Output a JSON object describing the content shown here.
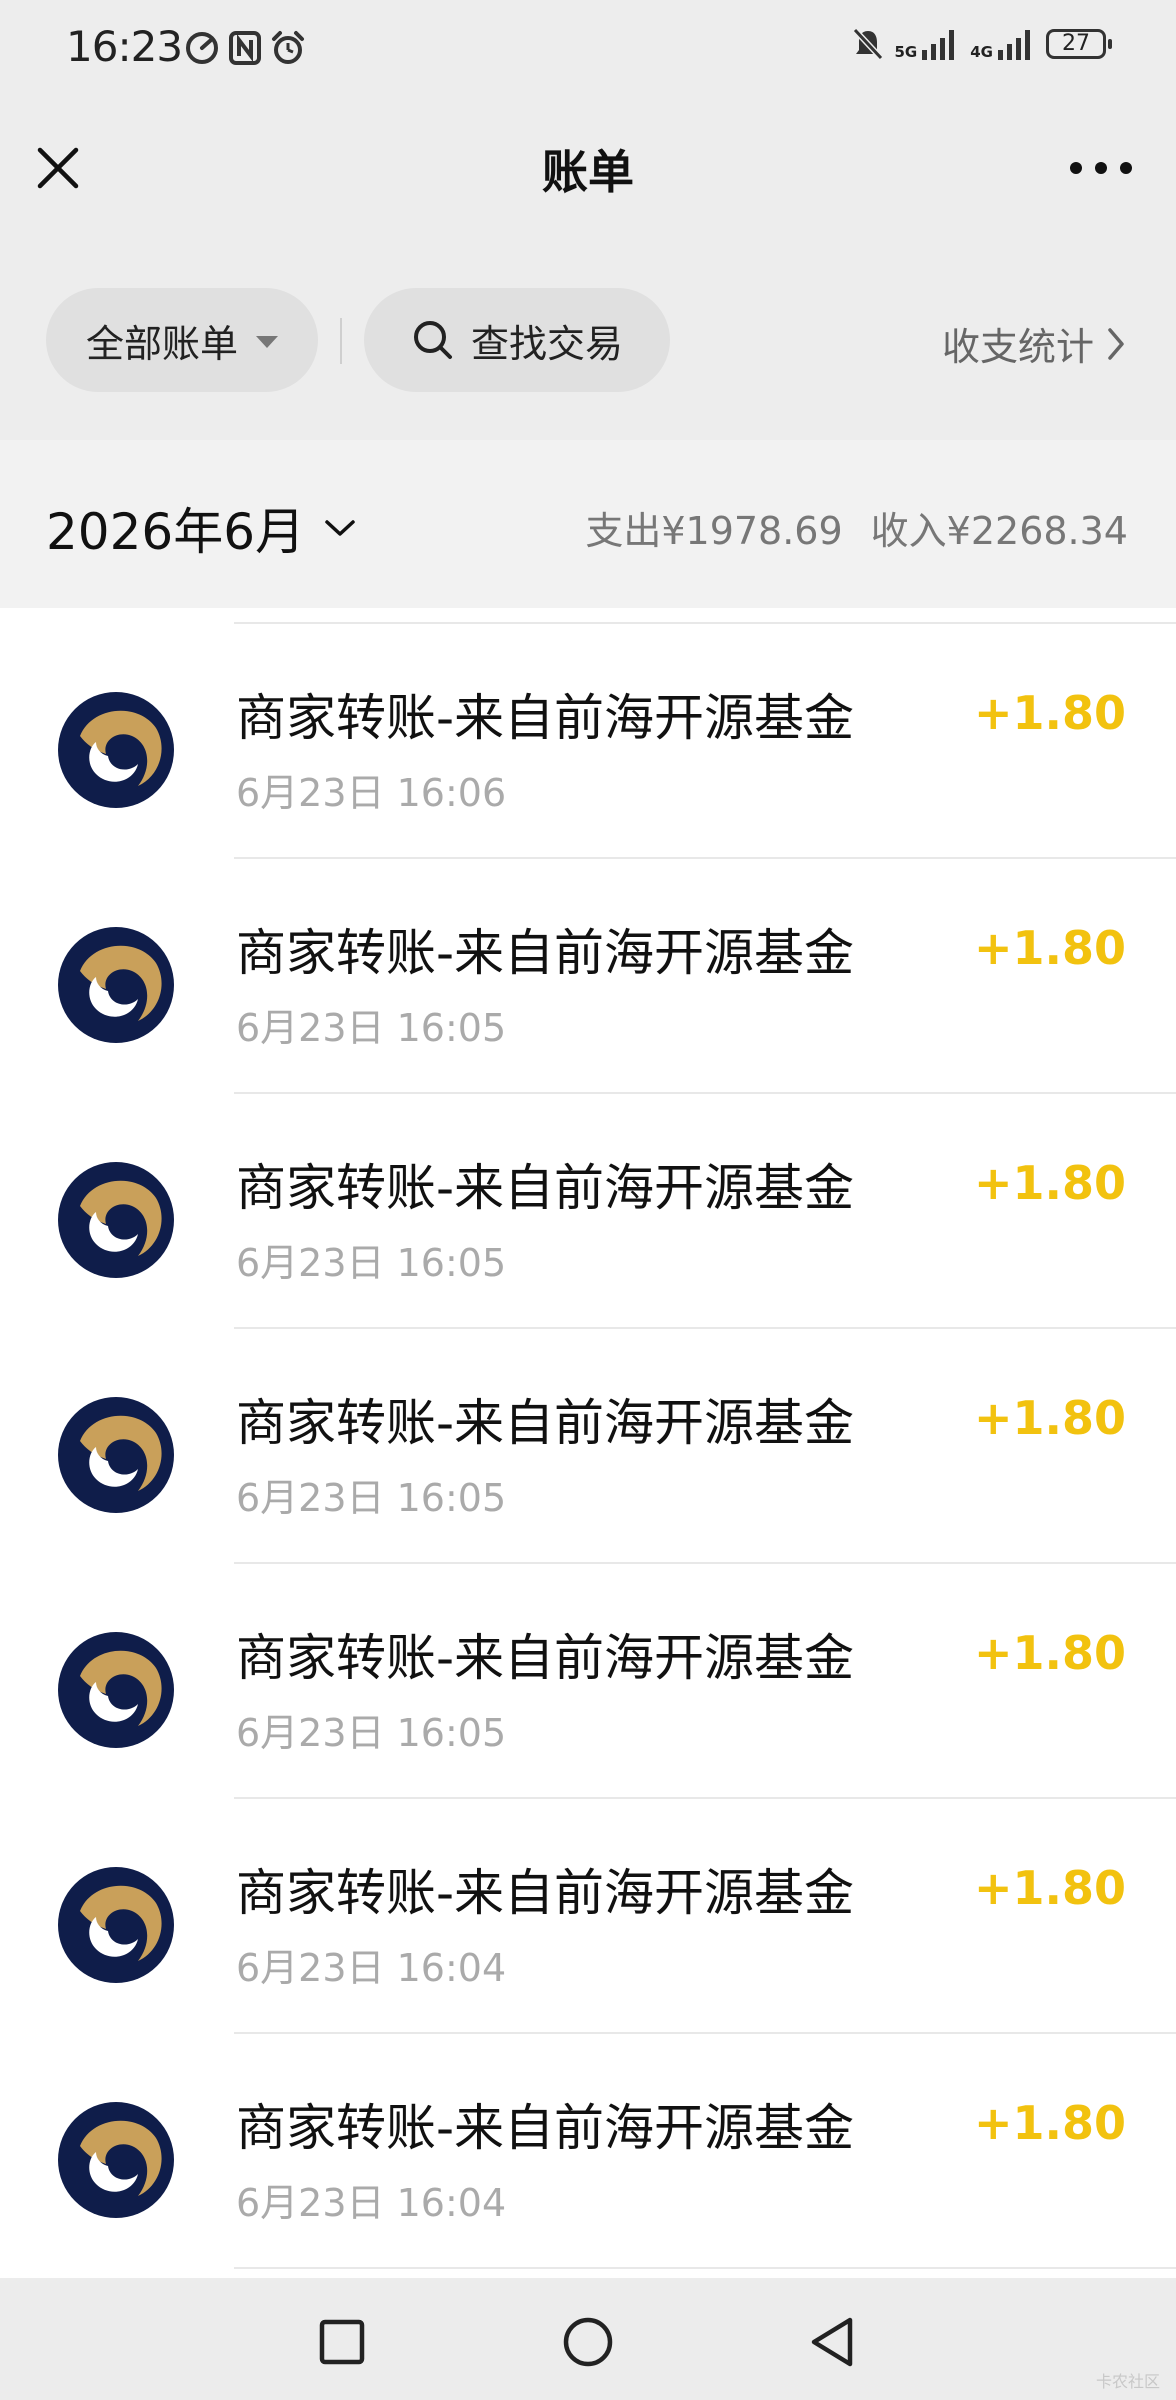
{
  "status_bar": {
    "time": "16:23",
    "net1": "5G",
    "net2": "4G",
    "battery": "27"
  },
  "nav": {
    "title": "账单"
  },
  "filters": {
    "all_bills": "全部账单",
    "search": "查找交易",
    "stats": "收支统计"
  },
  "month_bar": {
    "month": "2026年6月",
    "expense": "支出¥1978.69",
    "income": "收入¥2268.34"
  },
  "transactions": [
    {
      "title": "商家转账-来自前海开源基金",
      "time": "6月23日 16:06",
      "amount": "+1.80"
    },
    {
      "title": "商家转账-来自前海开源基金",
      "time": "6月23日 16:05",
      "amount": "+1.80"
    },
    {
      "title": "商家转账-来自前海开源基金",
      "time": "6月23日 16:05",
      "amount": "+1.80"
    },
    {
      "title": "商家转账-来自前海开源基金",
      "time": "6月23日 16:05",
      "amount": "+1.80"
    },
    {
      "title": "商家转账-来自前海开源基金",
      "time": "6月23日 16:05",
      "amount": "+1.80"
    },
    {
      "title": "商家转账-来自前海开源基金",
      "time": "6月23日 16:04",
      "amount": "+1.80"
    },
    {
      "title": "商家转账-来自前海开源基金",
      "time": "6月23日 16:04",
      "amount": "+1.80"
    }
  ],
  "colors": {
    "income_amount": "#f2c20f",
    "logo_navy": "#0f1d4a",
    "logo_gold": "#c9a05a"
  },
  "icons": {
    "close": "close-icon",
    "more": "more-icon",
    "search": "search-icon",
    "chevron": "chevron-right-icon"
  },
  "watermark": "卡农社区"
}
